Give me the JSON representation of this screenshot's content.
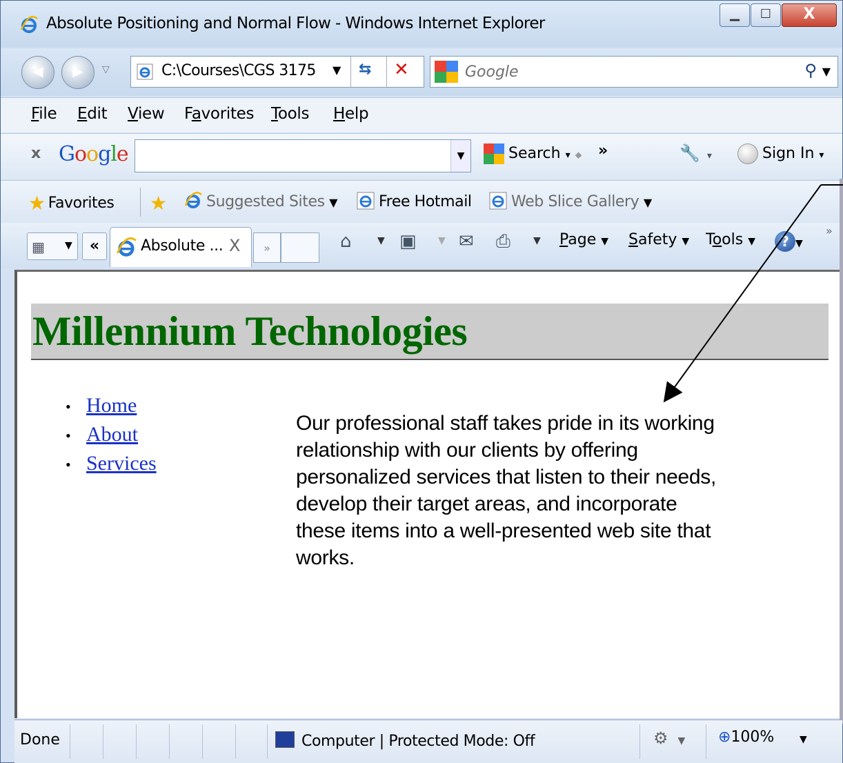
{
  "window": {
    "title": "Absolute Positioning and Normal Flow - Windows Internet Explorer",
    "controls": {
      "minimize": "▁",
      "maximize": "☐",
      "close": "X"
    }
  },
  "navigation": {
    "address": "C:\\Courses\\CGS 3175",
    "search_placeholder": "Google"
  },
  "menu": {
    "items": [
      {
        "label": "File",
        "key": "F",
        "rest": "ile"
      },
      {
        "label": "Edit",
        "key": "E",
        "rest": "dit"
      },
      {
        "label": "View",
        "key": "V",
        "rest": "iew"
      },
      {
        "label": "Favorites",
        "pre": "F",
        "key": "a",
        "rest": "vorites"
      },
      {
        "label": "Tools",
        "key": "T",
        "rest": "ools"
      },
      {
        "label": "Help",
        "key": "H",
        "rest": "elp"
      }
    ]
  },
  "google_toolbar": {
    "close": "x",
    "logo": "Google",
    "search_label": "Search",
    "more": "»",
    "signin_label": "Sign In"
  },
  "favorites_bar": {
    "favorites_label": "Favorites",
    "suggested_sites": "Suggested Sites",
    "free_hotmail": "Free Hotmail",
    "web_slice_gallery": "Web Slice Gallery"
  },
  "tabs": {
    "active_label": "Absolute ...",
    "close": "X",
    "scroll_left": "«",
    "scroll_right": "»"
  },
  "commands": {
    "page": {
      "key": "P",
      "rest": "age"
    },
    "safety": {
      "key": "S",
      "rest": "afety"
    },
    "tools": {
      "pre": "T",
      "key": "o",
      "rest": "ols"
    },
    "more": "»"
  },
  "page": {
    "heading": "Millennium Technologies",
    "nav_links": [
      "Home",
      "About",
      "Services"
    ],
    "paragraph": "Our professional staff takes pride in its working relationship with our clients by offering personalized services that listen to their needs, develop their target areas, and incorporate these items into a well-presented web site that works."
  },
  "status_bar": {
    "status": "Done",
    "zone": "Computer | Protected Mode: Off",
    "zoom": "100%"
  },
  "colors": {
    "heading_text": "#006600",
    "heading_bg": "#cccccc",
    "link": "#1a31c7"
  }
}
